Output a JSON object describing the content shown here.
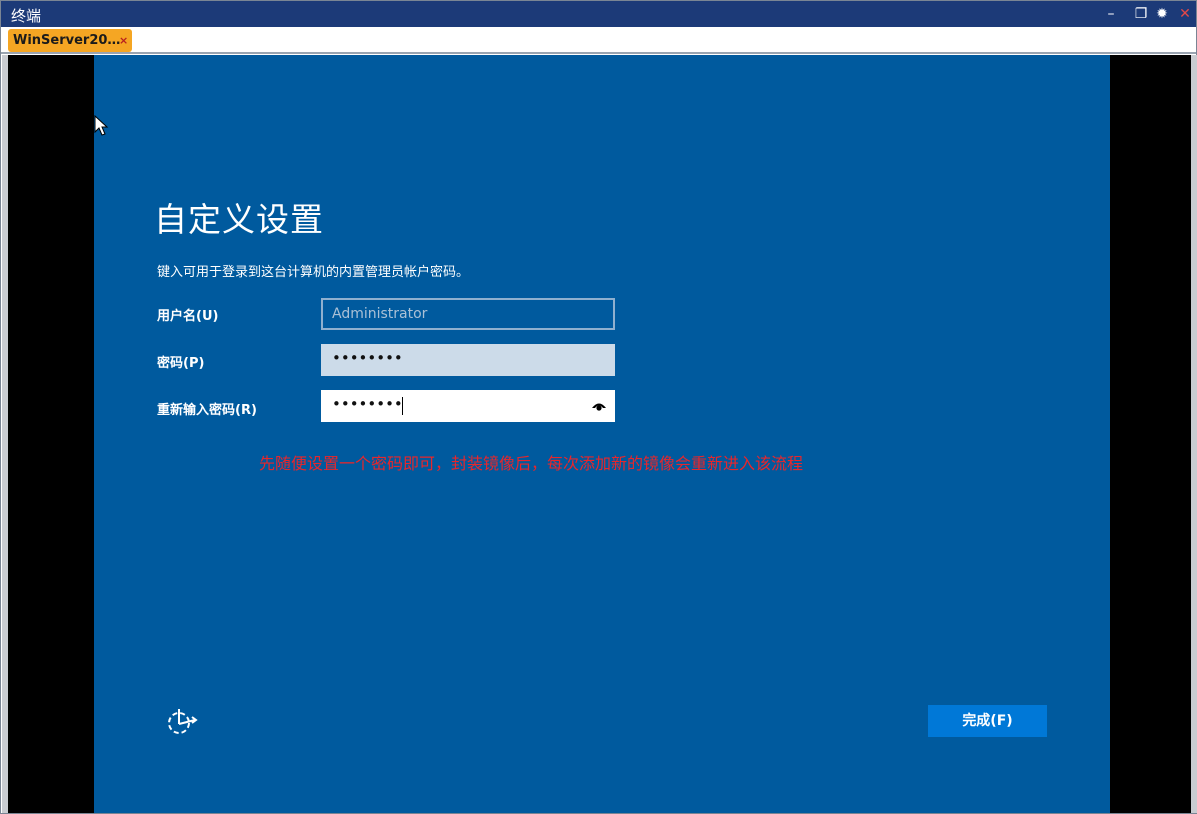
{
  "window": {
    "title": "终端",
    "controls": {
      "minimize": "–",
      "restore": "❐",
      "settings": "✹",
      "close": "✕"
    }
  },
  "tabs": [
    {
      "label": "WinServer20…",
      "close": "×"
    }
  ],
  "setup": {
    "heading": "自定义设置",
    "subtitle": "键入可用于登录到这台计算机的内置管理员帐户密码。",
    "username": {
      "label": "用户名(U)",
      "placeholder": "Administrator"
    },
    "password": {
      "label": "密码(P)",
      "value": "••••••••"
    },
    "confirm_password": {
      "label": "重新输入密码(R)",
      "value": "••••••••"
    },
    "annotation": "先随便设置一个密码即可，封装镜像后，每次添加新的镜像会重新进入该流程",
    "finish_button": "完成(F)"
  },
  "icons": {
    "cursor": "mouse-pointer-icon",
    "reveal": "eye-icon",
    "accessibility": "ease-of-access-icon"
  },
  "colors": {
    "titlebar": "#1c3a78",
    "tab": "#f5a623",
    "oobe_background": "#005a9e",
    "finish_button": "#0078d7",
    "annotation": "#e8262b"
  }
}
